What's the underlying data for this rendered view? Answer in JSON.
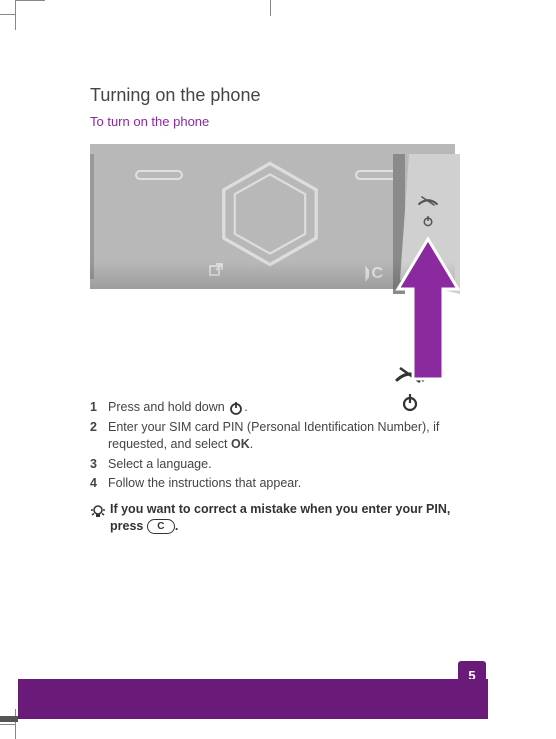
{
  "heading": "Turning on the phone",
  "subtitle": "To turn on the phone",
  "steps": [
    {
      "num": "1",
      "text_before": "Press and hold down ",
      "icon": "power",
      "text_after": "."
    },
    {
      "num": "2",
      "text_before": "Enter your SIM card PIN (Personal Identification Number), if requested, and select ",
      "bold": "OK",
      "text_after": "."
    },
    {
      "num": "3",
      "text_before": "Select a language.",
      "text_after": ""
    },
    {
      "num": "4",
      "text_before": "Follow the instructions that appear.",
      "text_after": ""
    }
  ],
  "tip": {
    "text_before": "If you want to correct a mistake when you enter your PIN, press ",
    "key_label": "C",
    "text_after": "."
  },
  "figure": {
    "c_label": "C"
  },
  "page_number": "5",
  "colors": {
    "accent": "#8b2a9e",
    "footer": "#6a1b7a"
  }
}
